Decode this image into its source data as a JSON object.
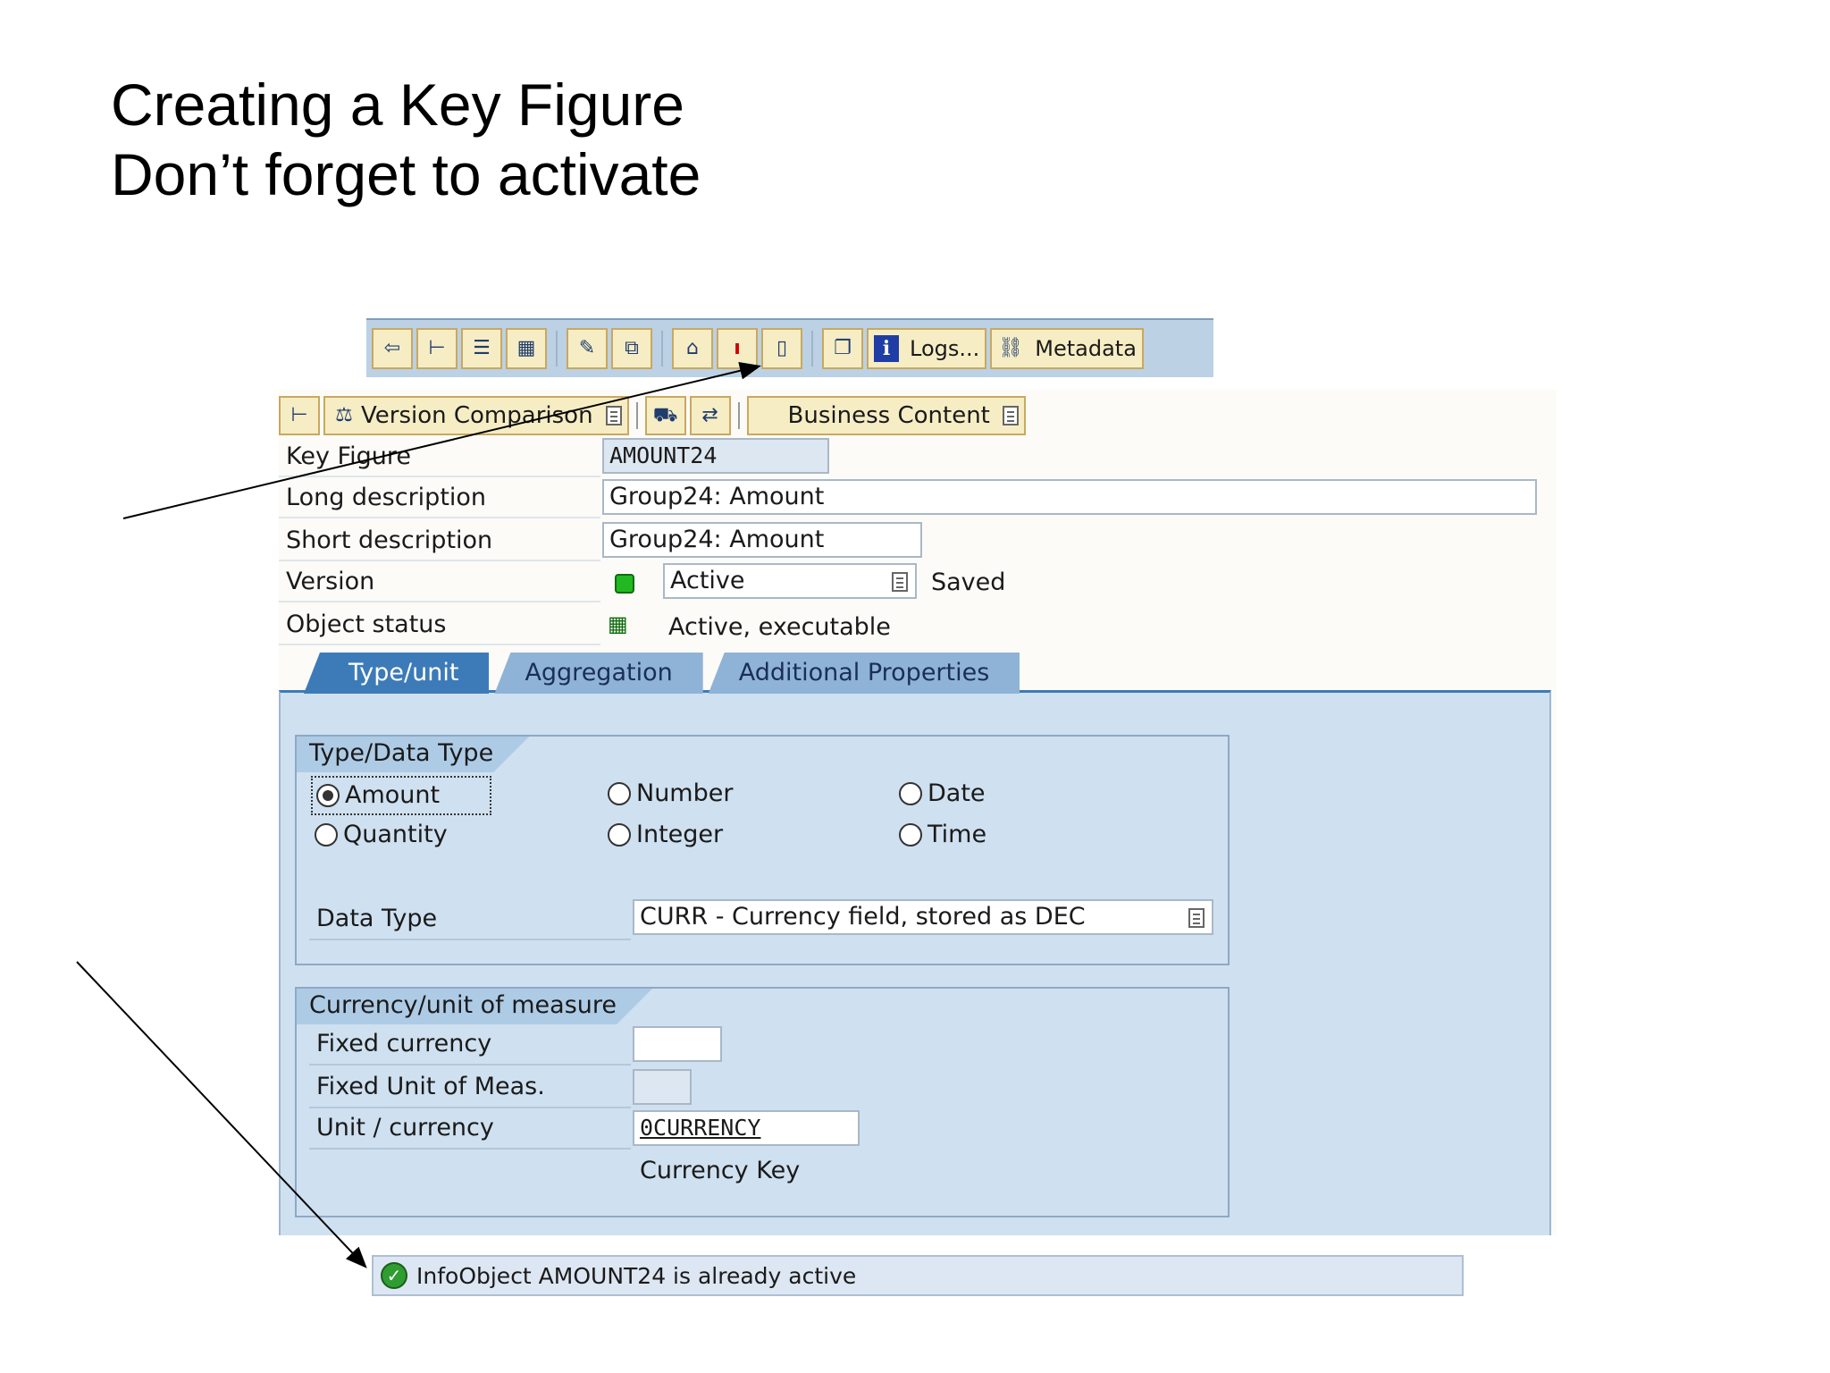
{
  "slide": {
    "title_line1": "Creating a Key Figure",
    "title_line2": "Don’t forget to activate"
  },
  "toolbar": {
    "buttons": [
      {
        "icon": "back-arrow-icon"
      },
      {
        "icon": "hierarchy-icon"
      },
      {
        "icon": "list-icon"
      },
      {
        "icon": "table-grid-icon"
      },
      {
        "icon": "check-icon"
      },
      {
        "icon": "transport-icon"
      },
      {
        "icon": "network-icon"
      },
      {
        "icon": "activate-icon"
      },
      {
        "icon": "new-document-icon"
      },
      {
        "icon": "copy-icon"
      }
    ],
    "logs_label": "Logs...",
    "metadata_label": "Metadata"
  },
  "sub_toolbar": {
    "version_comparison_label": "Version Comparison",
    "business_content_label": "Business Content"
  },
  "form": {
    "key_figure_label": "Key Figure",
    "key_figure_value": "AMOUNT24",
    "long_description_label": "Long description",
    "long_description_value": "Group24: Amount",
    "short_description_label": "Short description",
    "short_description_value": "Group24: Amount",
    "version_label": "Version",
    "version_value": "Active",
    "version_saved": "Saved",
    "object_status_label": "Object status",
    "object_status_value": "Active, executable"
  },
  "tabs": [
    {
      "label": "Type/unit",
      "active": true
    },
    {
      "label": "Aggregation",
      "active": false
    },
    {
      "label": "Additional Properties",
      "active": false
    }
  ],
  "type_group": {
    "title": "Type/Data Type",
    "options": {
      "amount": "Amount",
      "number": "Number",
      "date": "Date",
      "quantity": "Quantity",
      "integer": "Integer",
      "time": "Time"
    },
    "selected": "Amount",
    "data_type_label": "Data Type",
    "data_type_value": "CURR - Currency field, stored as DEC"
  },
  "currency_group": {
    "title": "Currency/unit of measure",
    "fixed_currency_label": "Fixed currency",
    "fixed_currency_value": "",
    "fixed_unit_label": "Fixed Unit of Meas.",
    "fixed_unit_value": "",
    "unit_currency_label": "Unit / currency",
    "unit_currency_value": "0CURRENCY",
    "unit_currency_desc": "Currency Key"
  },
  "status_bar": {
    "message": "InfoObject AMOUNT24 is already active"
  }
}
